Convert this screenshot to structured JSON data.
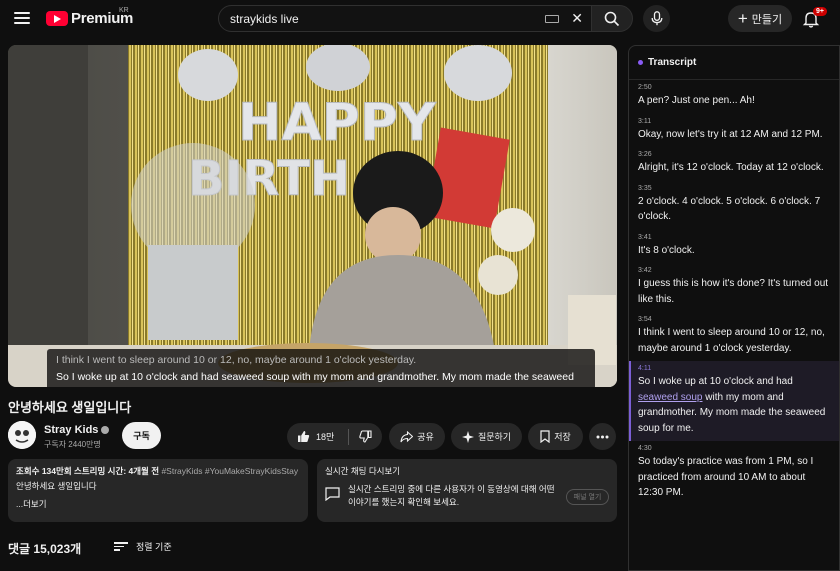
{
  "header": {
    "logo_text": "Premium",
    "region": "KR",
    "search_value": "straykids live",
    "create_label": "만들기",
    "notification_badge": "9+"
  },
  "video": {
    "caption_line1": "I think I went to sleep around 10 or 12, no, maybe around 1 o'clock yesterday.",
    "caption_line2": "So I woke up at 10 o'clock and had seaweed soup with my mom and grandmother. My mom made the seaweed soup for me.",
    "title": "안녕하세요 생일입니다",
    "channel_name": "Stray Kids",
    "subscribers": "구독자 2440만명",
    "subscribe_label": "구독",
    "like_count": "18만",
    "share_label": "공유",
    "ask_label": "질문하기",
    "save_label": "저장"
  },
  "description": {
    "views": "조회수 134만회",
    "stream_time": "스트리밍 시간: 4개월 전",
    "tags": "#StrayKids #YouMakeStrayKidsStay",
    "line": "안녕하세요 생일입니다",
    "more": "...더보기"
  },
  "live_chat": {
    "title": "실시간 채팅 다시보기",
    "body": "실시간 스트리밍 중에 다른 사용자가 이 동영상에 대해 어떤 이야기를 했는지 확인해 보세요.",
    "open_label": "패널 열기"
  },
  "comments": {
    "count": "댓글 15,023개",
    "sort_label": "정렬 기준"
  },
  "transcript": {
    "title": "Transcript",
    "segments": [
      {
        "time": "2:50",
        "text": "A pen? Just one pen... Ah!"
      },
      {
        "time": "3:11",
        "text": "Okay, now let's try it at 12 AM and 12 PM."
      },
      {
        "time": "3:26",
        "text": "Alright, it's 12 o'clock. Today at 12 o'clock."
      },
      {
        "time": "3:35",
        "text": "2 o'clock. 4 o'clock. 5 o'clock. 6 o'clock. 7 o'clock."
      },
      {
        "time": "3:41",
        "text": "It's 8 o'clock."
      },
      {
        "time": "3:42",
        "text": "I guess this is how it's done? It's turned out like this."
      },
      {
        "time": "3:54",
        "text": "I think I went to sleep around 10 or 12, no, maybe around 1 o'clock yesterday."
      },
      {
        "time": "4:11",
        "text_before": "So I woke up at 10 o'clock and had ",
        "highlight": "seaweed soup",
        "text_after": " with my mom and grandmother. My mom made the seaweed soup for me."
      },
      {
        "time": "4:30",
        "text": "So today's practice was from 1 PM, so I practiced from around 10 AM to about 12:30 PM."
      }
    ]
  },
  "colors": {
    "background": "#0f0f0f",
    "brand_red": "#ff0033",
    "active_accent": "#7c5fd6"
  },
  "icons": [
    "menu-icon",
    "youtube-logo-icon",
    "keyboard-icon",
    "clear-icon",
    "search-icon",
    "mic-icon",
    "plus-icon",
    "bell-icon",
    "verified-icon",
    "thumbs-up-icon",
    "thumbs-down-icon",
    "share-icon",
    "sparkle-icon",
    "bookmark-icon",
    "more-icon",
    "chat-icon",
    "sort-icon"
  ]
}
